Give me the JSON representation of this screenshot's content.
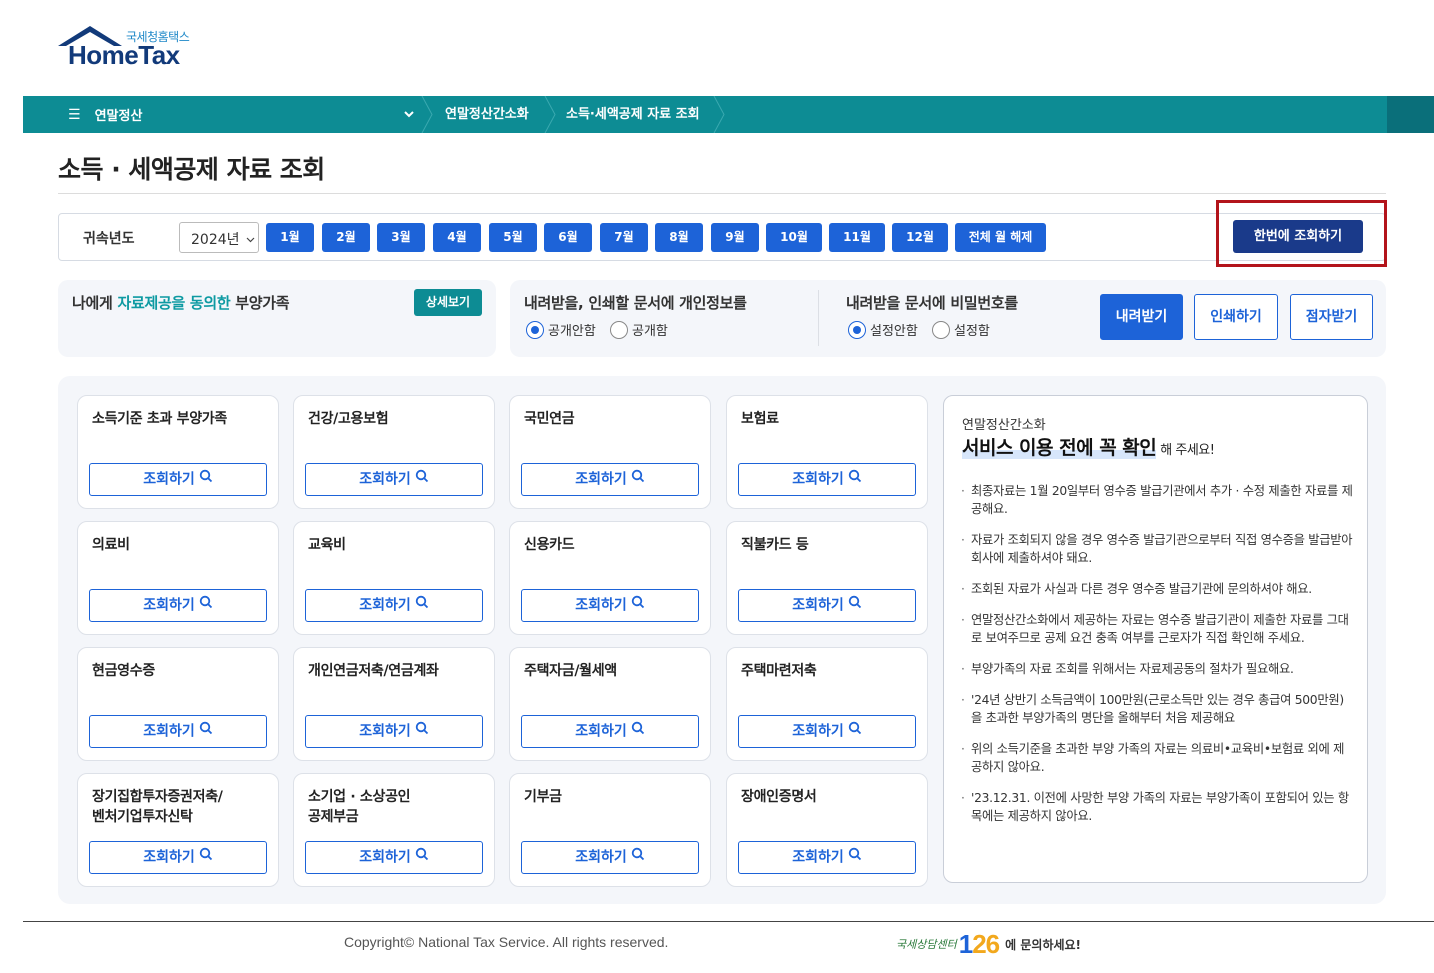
{
  "logo": {
    "korean": "국세청홈택스",
    "english": "HomeTax"
  },
  "nav": {
    "menu_label": "연말정산",
    "breadcrumb": [
      "연말정산간소화",
      "소득·세액공제 자료 조회"
    ]
  },
  "page_title": "소득 · 세액공제 자료 조회",
  "year_filter": {
    "label": "귀속년도",
    "selected_year": "2024년",
    "months": [
      "1월",
      "2월",
      "3월",
      "4월",
      "5월",
      "6월",
      "7월",
      "8월",
      "9월",
      "10월",
      "11월",
      "12월"
    ],
    "clear_all": "전체 월 해제",
    "query_all": "한번에 조회하기"
  },
  "dependents": {
    "prefix": "나에게 ",
    "highlight": "자료제공을 동의한",
    "suffix": " 부양가족",
    "detail_button": "상세보기"
  },
  "personal_info_option": {
    "title": "내려받을, 인쇄할 문서에 개인정보를",
    "options": [
      "공개안함",
      "공개함"
    ],
    "selected": "공개안함"
  },
  "password_option": {
    "title": "내려받을 문서에 비밀번호를",
    "options": [
      "설정안함",
      "설정함"
    ],
    "selected": "설정안함"
  },
  "actions": {
    "download": "내려받기",
    "print": "인쇄하기",
    "braille": "점자받기"
  },
  "query_label": "조회하기",
  "categories": [
    [
      "소득기준 초과 부양가족"
    ],
    [
      "건강/고용보험"
    ],
    [
      "국민연금"
    ],
    [
      "보험료"
    ],
    [
      "의료비"
    ],
    [
      "교육비"
    ],
    [
      "신용카드"
    ],
    [
      "직불카드 등"
    ],
    [
      "현금영수증"
    ],
    [
      "개인연금저축/연금계좌"
    ],
    [
      "주택자금/월세액"
    ],
    [
      "주택마련저축"
    ],
    [
      "장기집합투자증권저축/",
      "벤처기업투자신탁"
    ],
    [
      "소기업 · 소상공인",
      "공제부금"
    ],
    [
      "기부금"
    ],
    [
      "장애인증명서"
    ]
  ],
  "info": {
    "subtitle": "연말정산간소화",
    "headline": "서비스 이용 전에 꼭 확인",
    "headline_tail": "해 주세요!",
    "notes": [
      "최종자료는 1월 20일부터 영수증 발급기관에서 추가 · 수정 제출한 자료를 제공해요.",
      "자료가 조회되지 않을 경우 영수증 발급기관으로부터 직접 영수증을 발급받아 회사에 제출하셔야 돼요.",
      "조회된 자료가 사실과 다른 경우 영수증 발급기관에 문의하셔야 해요.",
      "연말정산간소화에서 제공하는 자료는 영수증 발급기관이 제출한 자료를 그대로 보여주므로 공제 요건 충족 여부를 근로자가 직접 확인해 주세요.",
      "부양가족의 자료 조회를 위해서는 자료제공동의 절차가 필요해요.",
      "'24년 상반기 소득금액이 100만원(근로소득만 있는 경우 총급여 500만원)을 초과한 부양가족의 명단을 올해부터 처음 제공해요",
      "위의 소득기준을 초과한 부양 가족의 자료는 의료비•교육비•보험료 외에 제공하지 않아요.",
      "'23.12.31. 이전에 사망한 부양 가족의 자료는 부양가족이 포함되어 있는 항목에는 제공하지 않아요."
    ]
  },
  "footer": {
    "copyright": "Copyright© National Tax Service. All rights reserved.",
    "call_center_label": "국세상담센터",
    "call_center_digits": [
      "1",
      "2",
      "6"
    ],
    "call_center_tail": "에 문의하세요!"
  },
  "colors": {
    "teal": "#0d8c94",
    "primary_blue": "#1d63d8",
    "navy": "#1a3a8a",
    "highlight_red": "#b3141b"
  }
}
